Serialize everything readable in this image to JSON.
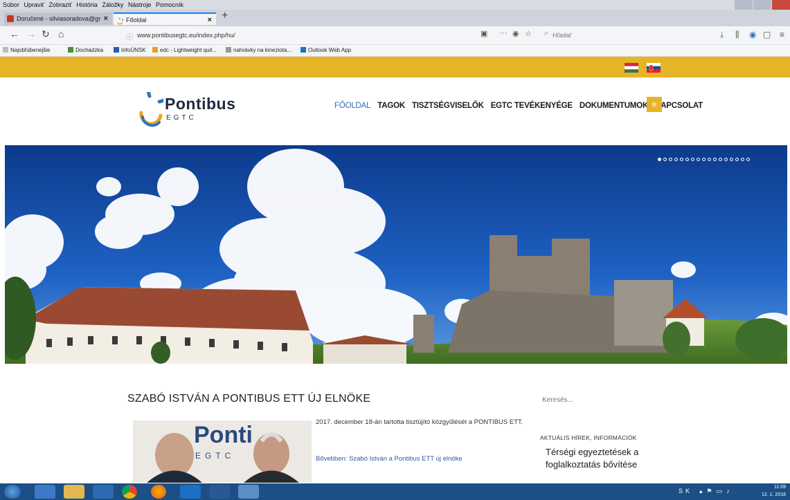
{
  "browser": {
    "menu": [
      "Súbor",
      "Upraviť",
      "Zobraziť",
      "História",
      "Záložky",
      "Nástroje",
      "Pomocník"
    ],
    "tabs": [
      {
        "label": "Doručené - silviasoradova@gr",
        "active": false
      },
      {
        "label": "Főoldal",
        "active": true
      }
    ],
    "new_tab": "+",
    "url": "www.pontibusegtc.eu/index.php/hu/",
    "search_placeholder": "Hľadať",
    "bookmarks": [
      {
        "label": "Najobľúbenejšie",
        "icon": "gear-icon"
      },
      {
        "label": "Dochádzka",
        "icon": "grid-icon"
      },
      {
        "label": "InfoÚNSK",
        "icon": "info-icon"
      },
      {
        "label": "edc - Lightweight quil...",
        "icon": "star-icon"
      },
      {
        "label": "nahrávky na kineziota...",
        "icon": "globe-icon"
      },
      {
        "label": "Outlook Web App",
        "icon": "mail-icon"
      }
    ]
  },
  "colors": {
    "accent": "#e6b427",
    "nav_active": "#2a6fb3",
    "logo_blue": "#2a77bd",
    "logo_orange": "#f0a020",
    "taskbar": "#1b4f86"
  },
  "site": {
    "logo": {
      "name": "Pontibus",
      "sub": "EGTC"
    },
    "nav": [
      {
        "label": "FŐOLDAL",
        "current": true
      },
      {
        "label": "TAGOK",
        "current": false
      },
      {
        "label": "TISZTSÉGVISELŐK",
        "current": false
      },
      {
        "label": "EGTC TEVÉKENYÉGE",
        "current": false
      },
      {
        "label": "DOKUMENTUMOK",
        "current": false
      },
      {
        "label": "KAPCSOLAT",
        "current": false
      }
    ],
    "menu_icon": "hamburger-icon",
    "slider_dot_count": 17,
    "slider_active_index": 0,
    "hero_alt": "castle-panorama"
  },
  "article": {
    "title": "SZABÓ ISTVÁN A PONTIBUS ETT ÚJ ELNÖKE",
    "excerpt": "2017. december 18-án tartotta tisztújító közgyűlését a PONTIBUS ETT.",
    "read_more": "Bővebben: Szabó István a Pontibus ETT új elnöke",
    "thumb_logo": "Ponti",
    "thumb_sub": "EGTC"
  },
  "sidebar": {
    "search_placeholder": "Keresés...",
    "heading": "AKTUÁLIS HÍREK, INFORMÁCIÓK",
    "news_title": "Térségi egyeztetések a foglalkoztatás bővítése"
  },
  "taskbar": {
    "apps": [
      "start",
      "ie",
      "explorer",
      "media",
      "chrome",
      "firefox",
      "outlook",
      "word",
      "network"
    ],
    "lang": "SK",
    "time": "11:09",
    "date": "12. 1. 2018"
  }
}
